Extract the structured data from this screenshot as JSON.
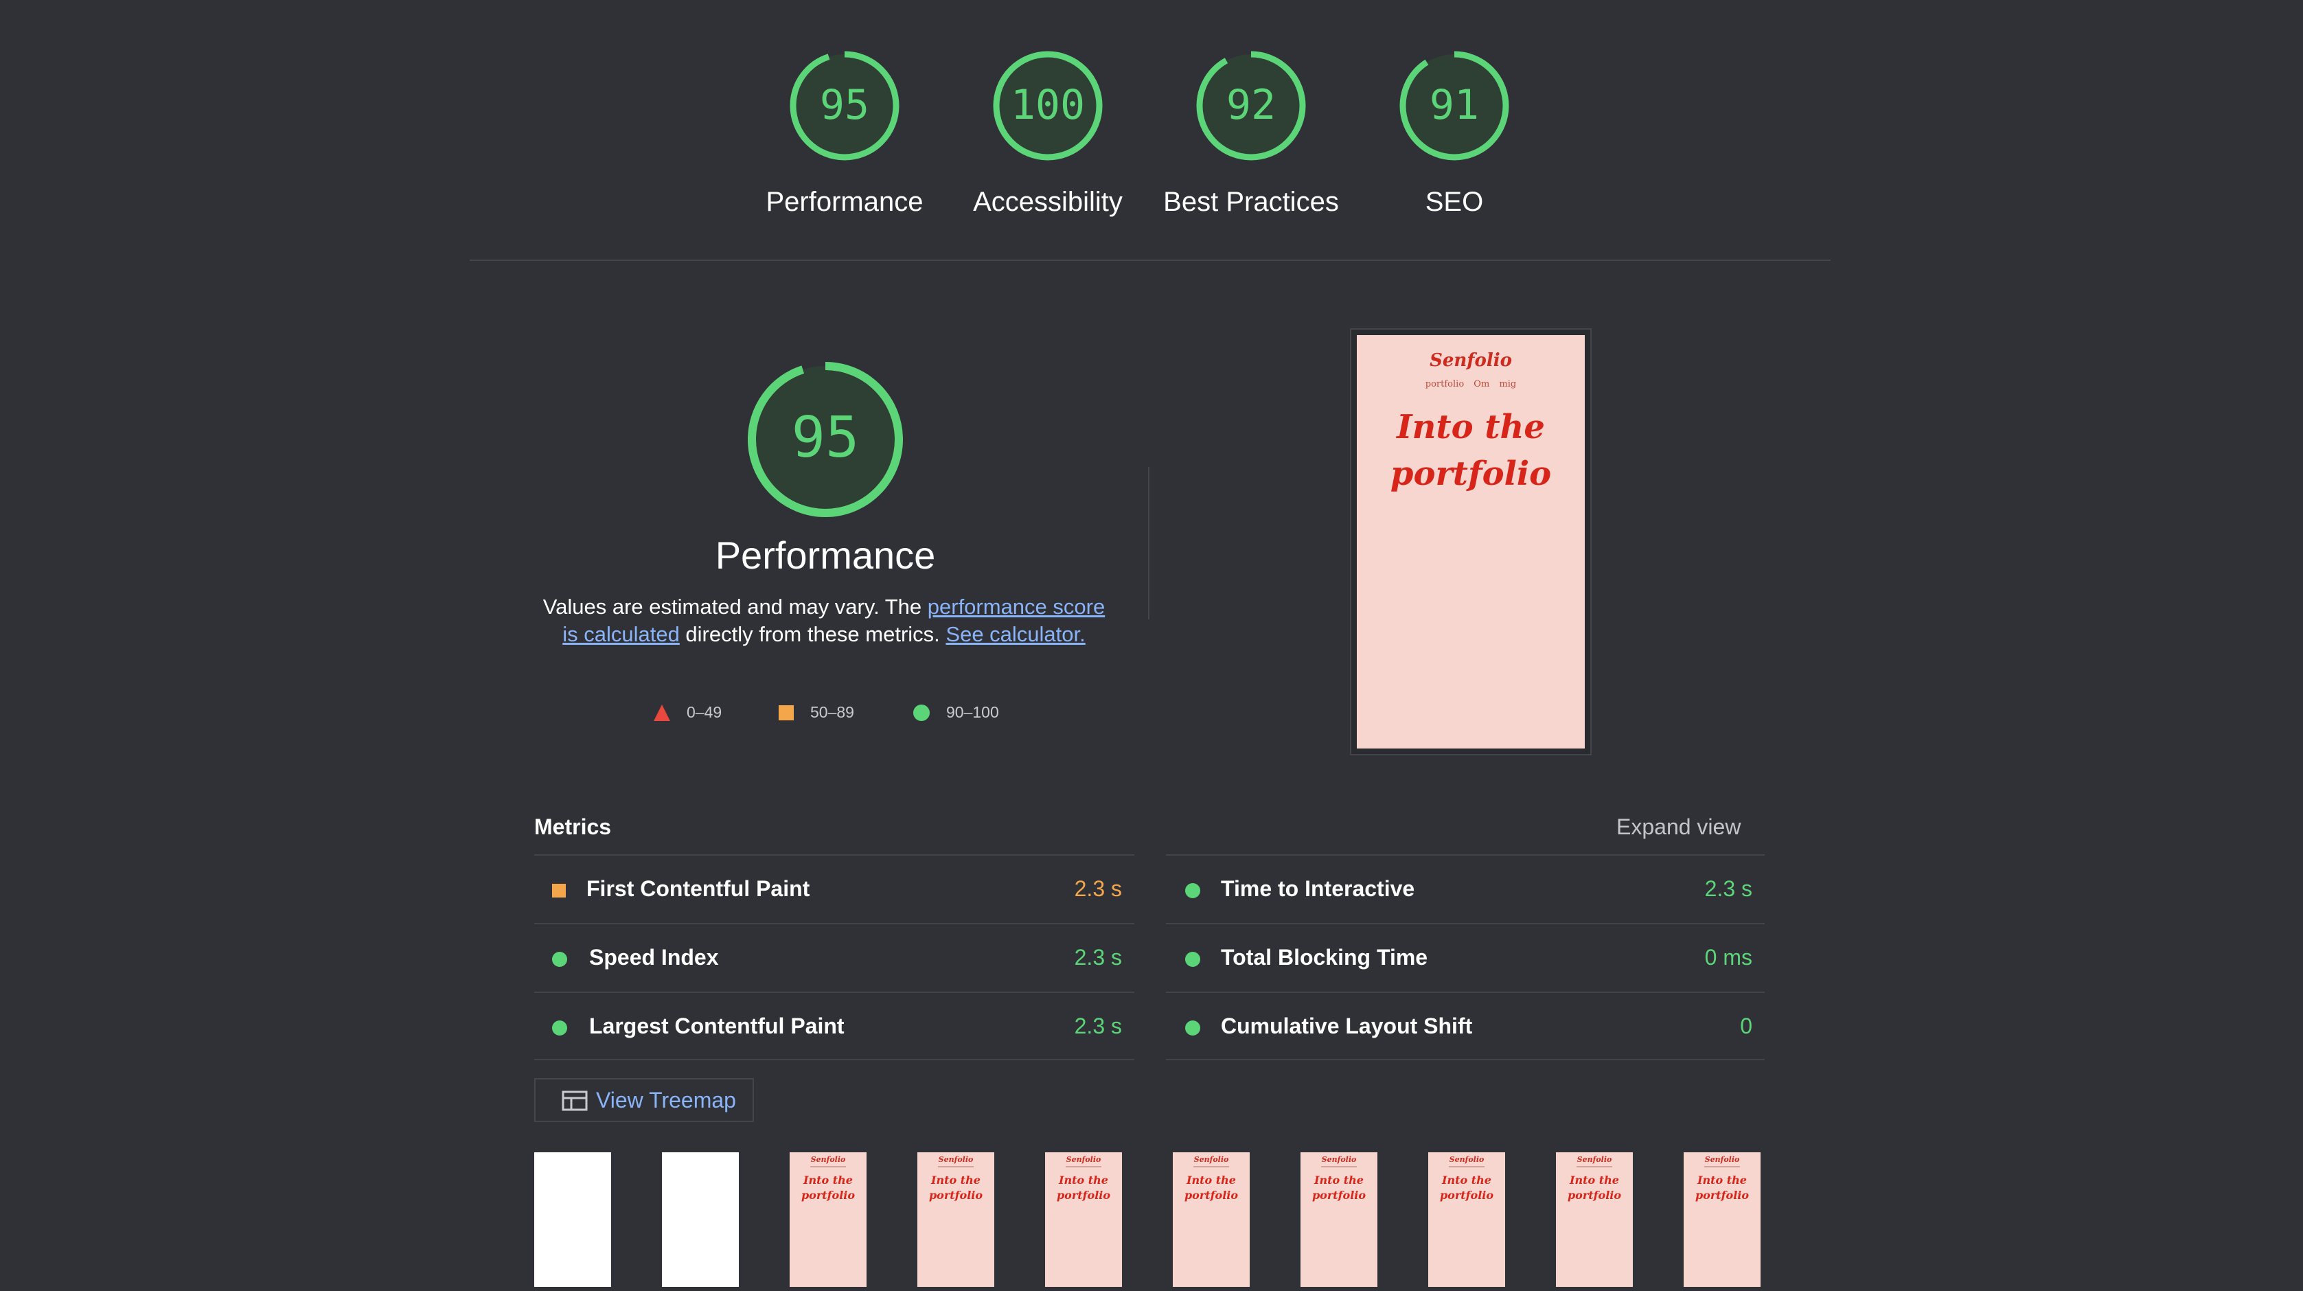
{
  "summary": [
    {
      "score": "95",
      "label": "Performance"
    },
    {
      "score": "100",
      "label": "Accessibility"
    },
    {
      "score": "92",
      "label": "Best Practices"
    },
    {
      "score": "91",
      "label": "SEO"
    }
  ],
  "performance": {
    "score": "95",
    "title": "Performance",
    "desc_prefix": "Values are estimated and may vary. The ",
    "desc_link1": "performance score is calculated",
    "desc_middle": " directly from these metrics. ",
    "desc_link2": "See calculator.",
    "legend": {
      "fail": "0–49",
      "average": "50–89",
      "pass": "90–100"
    }
  },
  "screenshot": {
    "brand": "Senfolio",
    "nav": "portfolio Om mig",
    "hero_line1": "Into the",
    "hero_line2": "portfolio"
  },
  "metrics": {
    "title": "Metrics",
    "expand": "Expand view",
    "left": [
      {
        "label": "First Contentful Paint",
        "value": "2.3 s",
        "rating": "average"
      },
      {
        "label": "Speed Index",
        "value": "2.3 s",
        "rating": "pass"
      },
      {
        "label": "Largest Contentful Paint",
        "value": "2.3 s",
        "rating": "pass"
      }
    ],
    "right": [
      {
        "label": "Time to Interactive",
        "value": "2.3 s",
        "rating": "pass"
      },
      {
        "label": "Total Blocking Time",
        "value": "0 ms",
        "rating": "pass"
      },
      {
        "label": "Cumulative Layout Shift",
        "value": "0",
        "rating": "pass"
      }
    ]
  },
  "treemap": {
    "label": "View Treemap"
  },
  "filmstrip": {
    "thumb_brand": "Senfolio",
    "thumb_hero_line1": "Into the",
    "thumb_hero_line2": "portfolio"
  },
  "colors": {
    "pass": "#5cd579",
    "average": "#f4a74a",
    "fail": "#e8483e",
    "link": "#8ab4f8",
    "background": "#303136"
  }
}
